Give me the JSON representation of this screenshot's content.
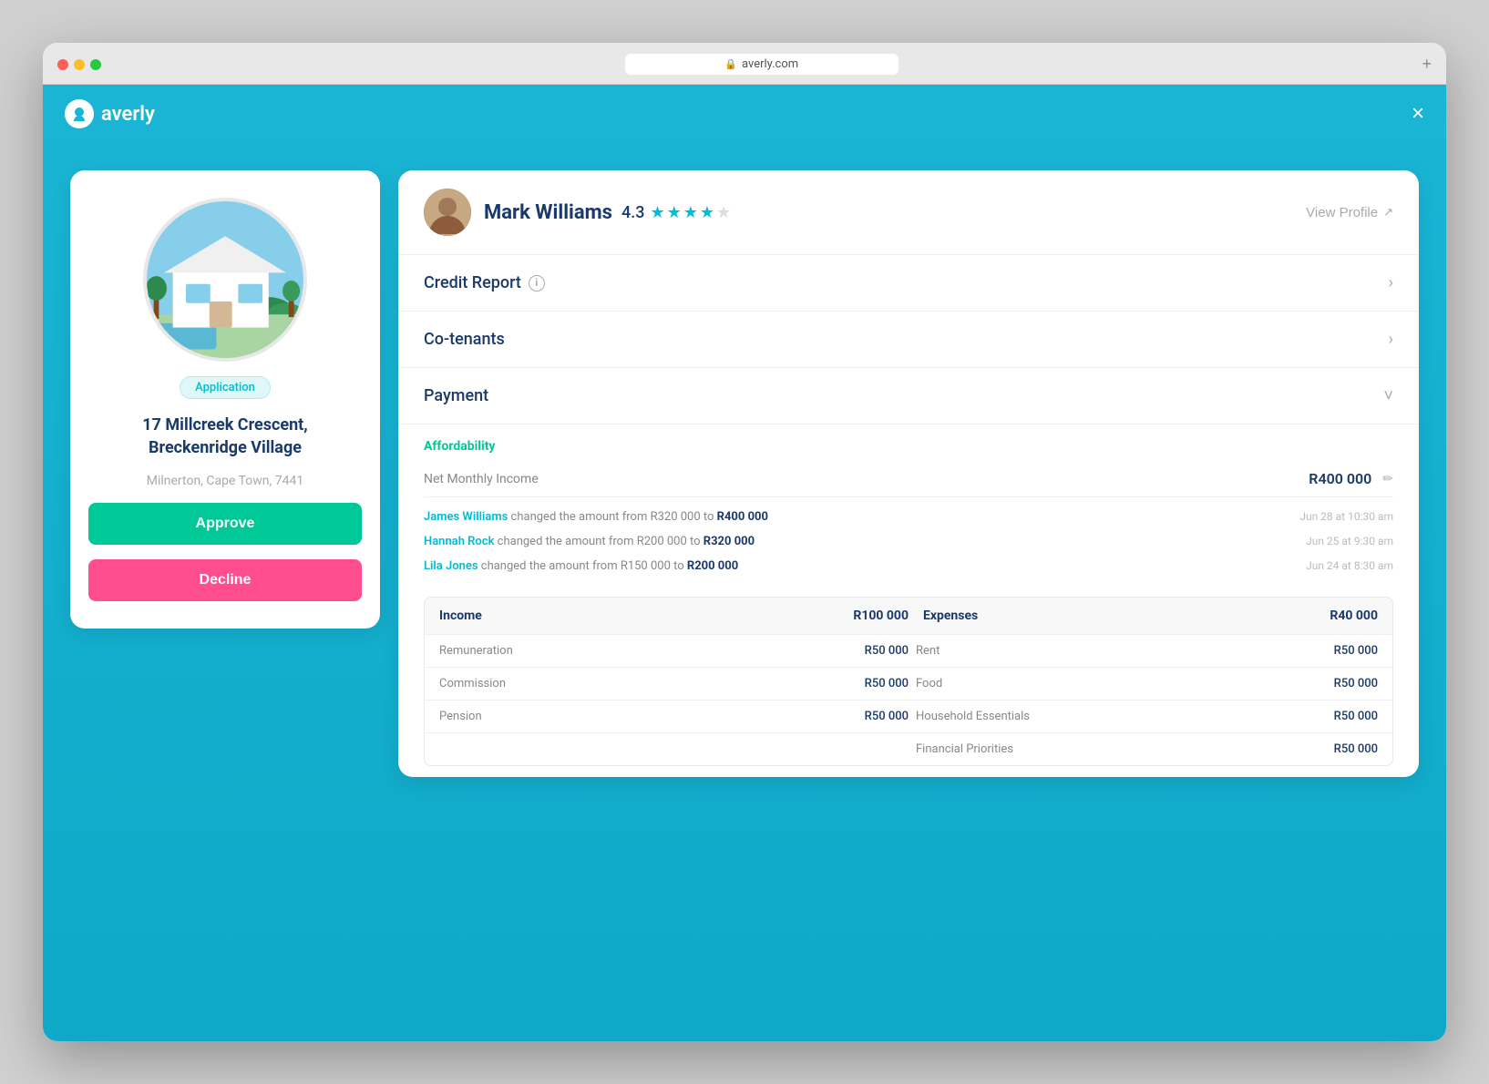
{
  "browser": {
    "url": "averly.com",
    "lock_icon": "🔒",
    "new_tab_icon": "+"
  },
  "header": {
    "logo_text": "averly",
    "close_icon": "×"
  },
  "left_card": {
    "badge_text": "Application",
    "address_line1": "17 Millcreek Crescent,",
    "address_line2": "Breckenridge Village",
    "suburb": "Milnerton, Cape Town, 7441",
    "approve_label": "Approve",
    "decline_label": "Decline"
  },
  "profile": {
    "name": "Mark Williams",
    "rating": "4.3",
    "view_profile_label": "View Profile",
    "stars": [
      true,
      true,
      true,
      true,
      false
    ]
  },
  "sections": {
    "credit_report": "Credit Report",
    "co_tenants": "Co-tenants",
    "payment": "Payment"
  },
  "affordability": {
    "section_label": "Affordability",
    "net_monthly_income_label": "Net Monthly Income",
    "net_monthly_income_value": "R400 000",
    "activity": [
      {
        "actor": "James Williams",
        "text": " changed the amount from R320 000 to ",
        "amount": "R400 000",
        "time": "Jun 28 at 10:30 am"
      },
      {
        "actor": "Hannah Rock",
        "text": " changed the amount from R200 000 to ",
        "amount": "R320 000",
        "time": "Jun 25 at 9:30 am"
      },
      {
        "actor": "Lila Jones",
        "text": " changed the amount from R150 000 to ",
        "amount": "R200 000",
        "time": "Jun 24 at 8:30 am"
      }
    ],
    "table": {
      "income_header": "Income",
      "income_total": "R100 000",
      "expenses_header": "Expenses",
      "expenses_total": "R40 000",
      "rows": [
        {
          "income_label": "Remuneration",
          "income_value": "R50 000",
          "expense_label": "Rent",
          "expense_value": "R50 000"
        },
        {
          "income_label": "Commission",
          "income_value": "R50 000",
          "expense_label": "Food",
          "expense_value": "R50 000"
        },
        {
          "income_label": "Pension",
          "income_value": "R50 000",
          "expense_label": "Household Essentials",
          "expense_value": "R50 000"
        },
        {
          "income_label": "",
          "income_value": "",
          "expense_label": "Financial Priorities",
          "expense_value": "R50 000"
        }
      ]
    }
  },
  "colors": {
    "blue_accent": "#1ab5d4",
    "green_accent": "#00c896",
    "pink_accent": "#ff4d8d",
    "dark_blue": "#1a3a6b"
  }
}
